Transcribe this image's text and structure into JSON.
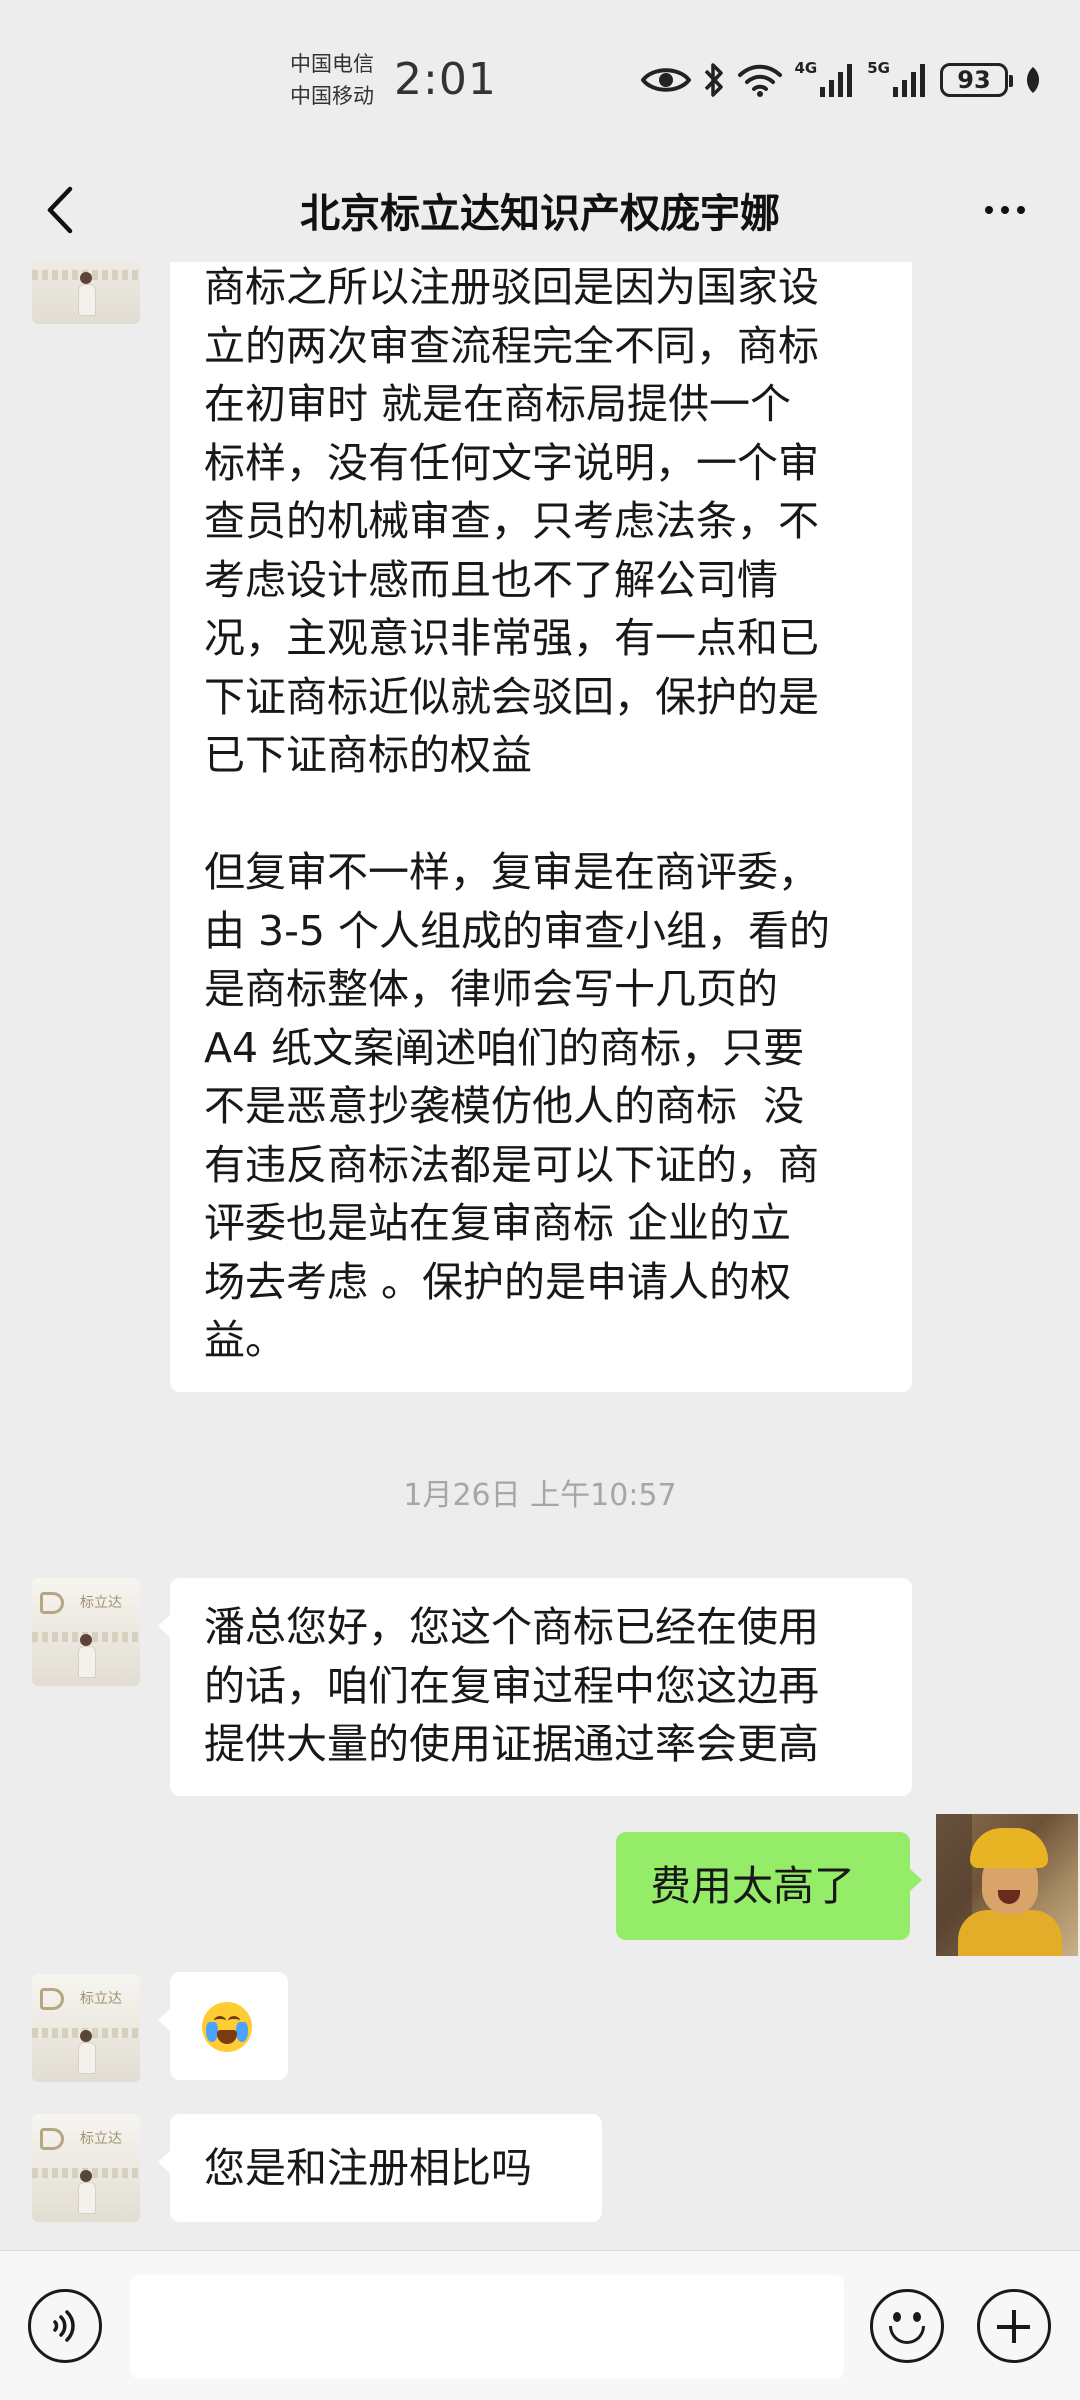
{
  "status_bar": {
    "carrier_1": "中国电信",
    "carrier_2": "中国移动",
    "time": "2:01",
    "network_1": "4G",
    "network_2": "5G",
    "battery": "93"
  },
  "nav": {
    "title": "北京标立达知识产权庞宇娜",
    "back_icon": "chevron-left-icon",
    "more_icon": "more-dots-icon"
  },
  "avatar_logo_text": "标立达",
  "messages": {
    "msg1": {
      "sender": "other",
      "lines": [
        "商标之所以注册驳回是因为国家设",
        "立的两次审查流程完全不同，商标",
        "在初审时 就是在商标局提供一个",
        "标样，没有任何文字说明，一个审",
        "查员的机械审查，只考虑法条，不",
        "考虑设计感而且也不了解公司情",
        "况，主观意识非常强，有一点和已",
        "下证商标近似就会驳回，保护的是",
        "已下证商标的权益",
        "",
        "但复审不一样，复审是在商评委，",
        "由 3-5 个人组成的审查小组，看的",
        "是商标整体，律师会写十几页的",
        "A4 纸文案阐述咱们的商标，只要",
        "不是恶意抄袭模仿他人的商标  没",
        "有违反商标法都是可以下证的，商",
        "评委也是站在复审商标 企业的立",
        "场去考虑 。保护的是申请人的权",
        "益。"
      ]
    },
    "timestamp": "1月26日 上午10:57",
    "msg2": {
      "sender": "other",
      "lines": [
        "潘总您好，您这个商标已经在使用",
        "的话，咱们在复审过程中您这边再",
        "提供大量的使用证据通过率会更高"
      ]
    },
    "msg3": {
      "sender": "self",
      "text": "费用太高了"
    },
    "msg4": {
      "sender": "other",
      "emoji": "loudly-crying-face-emoji"
    },
    "msg5": {
      "sender": "other",
      "text": "您是和注册相比吗"
    }
  },
  "input_bar": {
    "voice_icon": "voice-icon",
    "input_placeholder": "",
    "emoji_icon": "emoji-icon",
    "plus_icon": "plus-icon"
  }
}
